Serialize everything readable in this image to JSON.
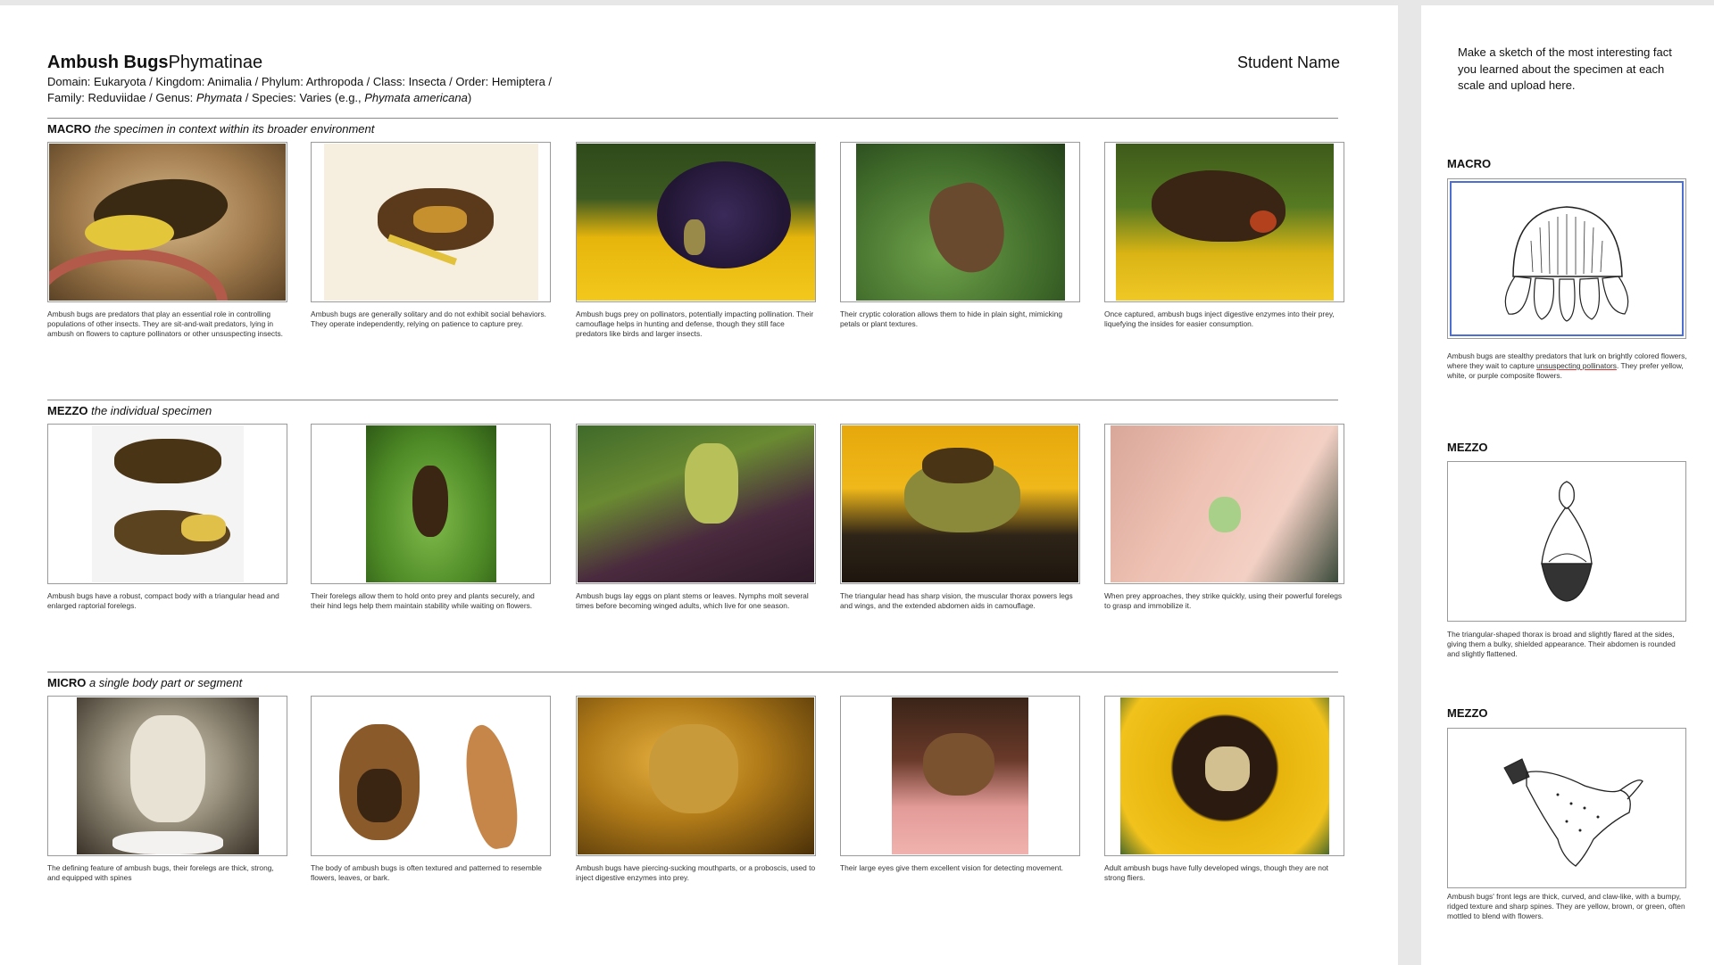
{
  "header": {
    "title_bold": "Ambush Bugs",
    "title_rest": "Phymatinae",
    "taxonomy_line1": "Domain: Eukaryota / Kingdom: Animalia / Phylum: Arthropoda / Class: Insecta / Order: Hemiptera /",
    "taxonomy_line2_prefix": "Family: Reduviidae / Genus: ",
    "taxonomy_genus": "Phymata",
    "taxonomy_species_prefix": " / Species: Varies (e.g., ",
    "taxonomy_species": "Phymata americana",
    "taxonomy_close": ")",
    "student_name": "Student Name"
  },
  "sections": [
    {
      "name": "MACRO",
      "desc": "the specimen in context within its broader environment",
      "cards": [
        {
          "caption": "Ambush bugs are predators that play an essential role in controlling populations of other insects. They are sit-and-wait predators, lying in ambush on flowers to capture pollinators or other unsuspecting insects.",
          "photo": "bug-on-stem"
        },
        {
          "caption": "Ambush bugs are generally solitary and do not exhibit social behaviors. They operate independently, relying on patience to capture prey.",
          "photo": "bug-top-view"
        },
        {
          "caption": "Ambush bugs prey on pollinators, potentially impacting pollination. Their camouflage helps in hunting and defense, though they still face predators like birds and larger insects.",
          "photo": "bug-on-coneflower"
        },
        {
          "caption": "Their cryptic coloration allows them to hide in plain sight, mimicking petals or plant textures.",
          "photo": "bug-on-leaf"
        },
        {
          "caption": "Once captured, ambush bugs inject digestive enzymes into their prey, liquefying the insides for easier consumption.",
          "photo": "bug-eating-prey"
        }
      ]
    },
    {
      "name": "MEZZO",
      "desc": "the individual specimen",
      "cards": [
        {
          "caption": "Ambush bugs have a robust, compact body with a triangular head and enlarged raptorial forelegs.",
          "photo": "specimen-dorsal-lateral"
        },
        {
          "caption": "Their forelegs allow them to hold onto prey and plants securely, and their hind legs help them maintain stability while waiting on flowers.",
          "photo": "bug-on-green-leaf"
        },
        {
          "caption": "Ambush bugs lay eggs on plant stems or leaves. Nymphs molt several times before becoming winged adults, which live for one season.",
          "photo": "bug-on-purple-flower"
        },
        {
          "caption": "The triangular head has sharp vision, the muscular thorax powers legs and wings, and the extended abdomen aids in camouflage.",
          "photo": "bug-pair-on-flower"
        },
        {
          "caption": "When prey approaches, they strike quickly, using their powerful forelegs to grasp and immobilize it.",
          "photo": "nymph-on-finger"
        }
      ]
    },
    {
      "name": "MICRO",
      "desc": "a single body part or segment",
      "cards": [
        {
          "caption": "The defining feature of ambush bugs, their forelegs are thick, strong, and equipped with spines",
          "photo": "foreleg-closeup"
        },
        {
          "caption": "The body of ambush bugs is often textured and patterned to resemble flowers, leaves, or bark.",
          "photo": "specimen-with-leg-detail"
        },
        {
          "caption": "Ambush bugs have piercing-sucking mouthparts, or a proboscis, used to inject digestive enzymes into prey.",
          "photo": "mouthparts-closeup"
        },
        {
          "caption": "Their large eyes give them excellent vision for detecting movement.",
          "photo": "bug-on-finger"
        },
        {
          "caption": "Adult ambush bugs have fully developed wings, though they are not strong fliers.",
          "photo": "bug-on-black-eyed-susan"
        }
      ]
    }
  ],
  "side_panel": {
    "intro": "Make a sketch of the most interesting fact you learned about the specimen at each scale and upload here.",
    "items": [
      {
        "label": "MACRO",
        "caption_pre": "Ambush bugs are stealthy predators that lurk on brightly colored flowers, where they wait to capture ",
        "caption_ul": "unsuspecting pollinators",
        "caption_post": ". They prefer yellow, white, or purple composite flowers.",
        "sketch": "coneflower-sketch"
      },
      {
        "label": "MEZZO",
        "caption_pre": "The triangular-shaped thorax is broad and slightly flared at the sides, giving them a bulky, shielded appearance. Their abdomen is rounded and slightly flattened.",
        "caption_ul": "",
        "caption_post": "",
        "sketch": "body-sketch"
      },
      {
        "label": "MEZZO",
        "caption_pre": "Ambush bugs' front legs are thick, curved, and claw-like, with a bumpy, ridged texture and sharp spines. They are yellow, brown, or green, often mottled to blend with flowers.",
        "caption_ul": "",
        "caption_post": "",
        "sketch": "foreleg-sketch"
      }
    ]
  },
  "colors": {
    "page_bg": "#e7e7e7",
    "selection_outline": "#4d6fd1",
    "annotation_underline": "#dd3333"
  }
}
